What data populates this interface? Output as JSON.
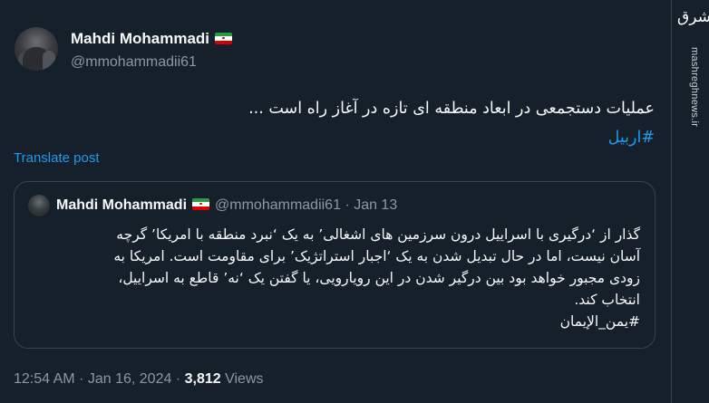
{
  "author": {
    "name": "Mahdi Mohammadi",
    "handle": "@mmohammadii61",
    "flag": "iran-flag"
  },
  "tweet": {
    "text": "عملیات دستجمعی در ابعاد منطقه ای تازه در آغاز راه است ...",
    "hashtag": "#اربیل",
    "translate_label": "Translate post"
  },
  "quote": {
    "name": "Mahdi Mohammadi",
    "handle_date": "@mmohammadii61 · Jan 13",
    "lines": [
      "گذار از ‘درگیری با اسراییل درون سرزمین های اشغالی’ به یک ‘نبرد منطقه با امریکا’ گرچه",
      "آسان نیست، اما در حال تبدیل شدن به یک ‘اجبار استراتژیک’ برای مقاومت است. امریکا به",
      "زودی مجبور خواهد بود بین درگیر شدن در این رویارویی، یا گفتن یک ‘نه’ قاطع به اسراییل،",
      "انتخاب کند."
    ],
    "hashtag": "#یمن_الإیمان"
  },
  "footer": {
    "time": "12:54 AM",
    "separator": "·",
    "date": "Jan 16, 2024",
    "views_count": "3,812",
    "views_label": "Views"
  },
  "watermark": {
    "logo_text": "مشرق",
    "url": "mashreghnews.ir"
  },
  "colors": {
    "background": "#15202b",
    "text": "#f7f9f9",
    "secondary": "#8b98a5",
    "accent": "#1d9bf0",
    "border": "#38444d"
  }
}
